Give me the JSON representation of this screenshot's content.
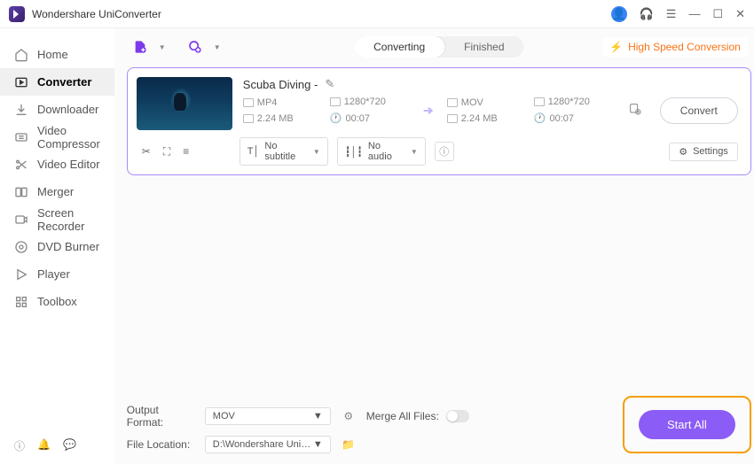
{
  "app": {
    "title": "Wondershare UniConverter"
  },
  "sidebar": {
    "items": [
      {
        "label": "Home"
      },
      {
        "label": "Converter"
      },
      {
        "label": "Downloader"
      },
      {
        "label": "Video Compressor"
      },
      {
        "label": "Video Editor"
      },
      {
        "label": "Merger"
      },
      {
        "label": "Screen Recorder"
      },
      {
        "label": "DVD Burner"
      },
      {
        "label": "Player"
      },
      {
        "label": "Toolbox"
      }
    ]
  },
  "tabs": {
    "converting": "Converting",
    "finished": "Finished"
  },
  "banner": {
    "highspeed": "High Speed Conversion"
  },
  "file": {
    "title": "Scuba Diving  -",
    "src": {
      "format": "MP4",
      "res": "1280*720",
      "size": "2.24 MB",
      "dur": "00:07"
    },
    "dst": {
      "format": "MOV",
      "res": "1280*720",
      "size": "2.24 MB",
      "dur": "00:07"
    },
    "convert": "Convert",
    "subtitle": "No subtitle",
    "audio": "No audio",
    "settings": "Settings"
  },
  "footer": {
    "outfmt_label": "Output Format:",
    "outfmt_value": "MOV",
    "loc_label": "File Location:",
    "loc_value": "D:\\Wondershare UniConverter",
    "merge_label": "Merge All Files:",
    "start": "Start All"
  }
}
